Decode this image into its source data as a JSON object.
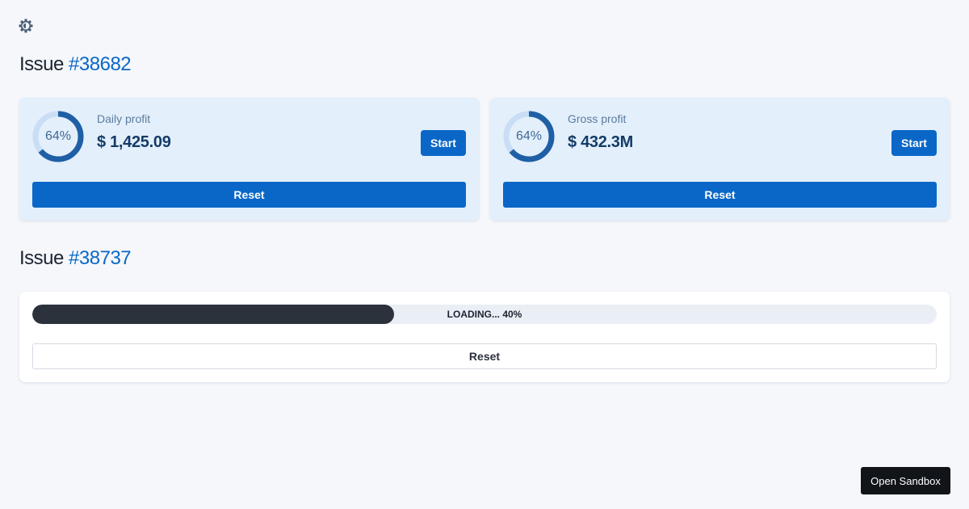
{
  "sections": [
    {
      "title_prefix": "Issue",
      "title_number": "#38682",
      "cards": [
        {
          "percent": 64,
          "percent_label": "64%",
          "label": "Daily profit",
          "value": "$ 1,425.09",
          "start_label": "Start",
          "reset_label": "Reset"
        },
        {
          "percent": 64,
          "percent_label": "64%",
          "label": "Gross profit",
          "value": "$ 432.3M",
          "start_label": "Start",
          "reset_label": "Reset"
        }
      ]
    },
    {
      "title_prefix": "Issue",
      "title_number": "#38737",
      "progress": {
        "percent": 40,
        "label": "LOADING... 40%"
      },
      "reset_label": "Reset"
    }
  ],
  "footer": {
    "sandbox_label": "Open Sandbox"
  },
  "icons": {
    "settings": "gear-icon"
  },
  "colors": {
    "accent": "#0a67c7",
    "progress_fill": "#2c323c",
    "card_bg": "#e3effb"
  }
}
